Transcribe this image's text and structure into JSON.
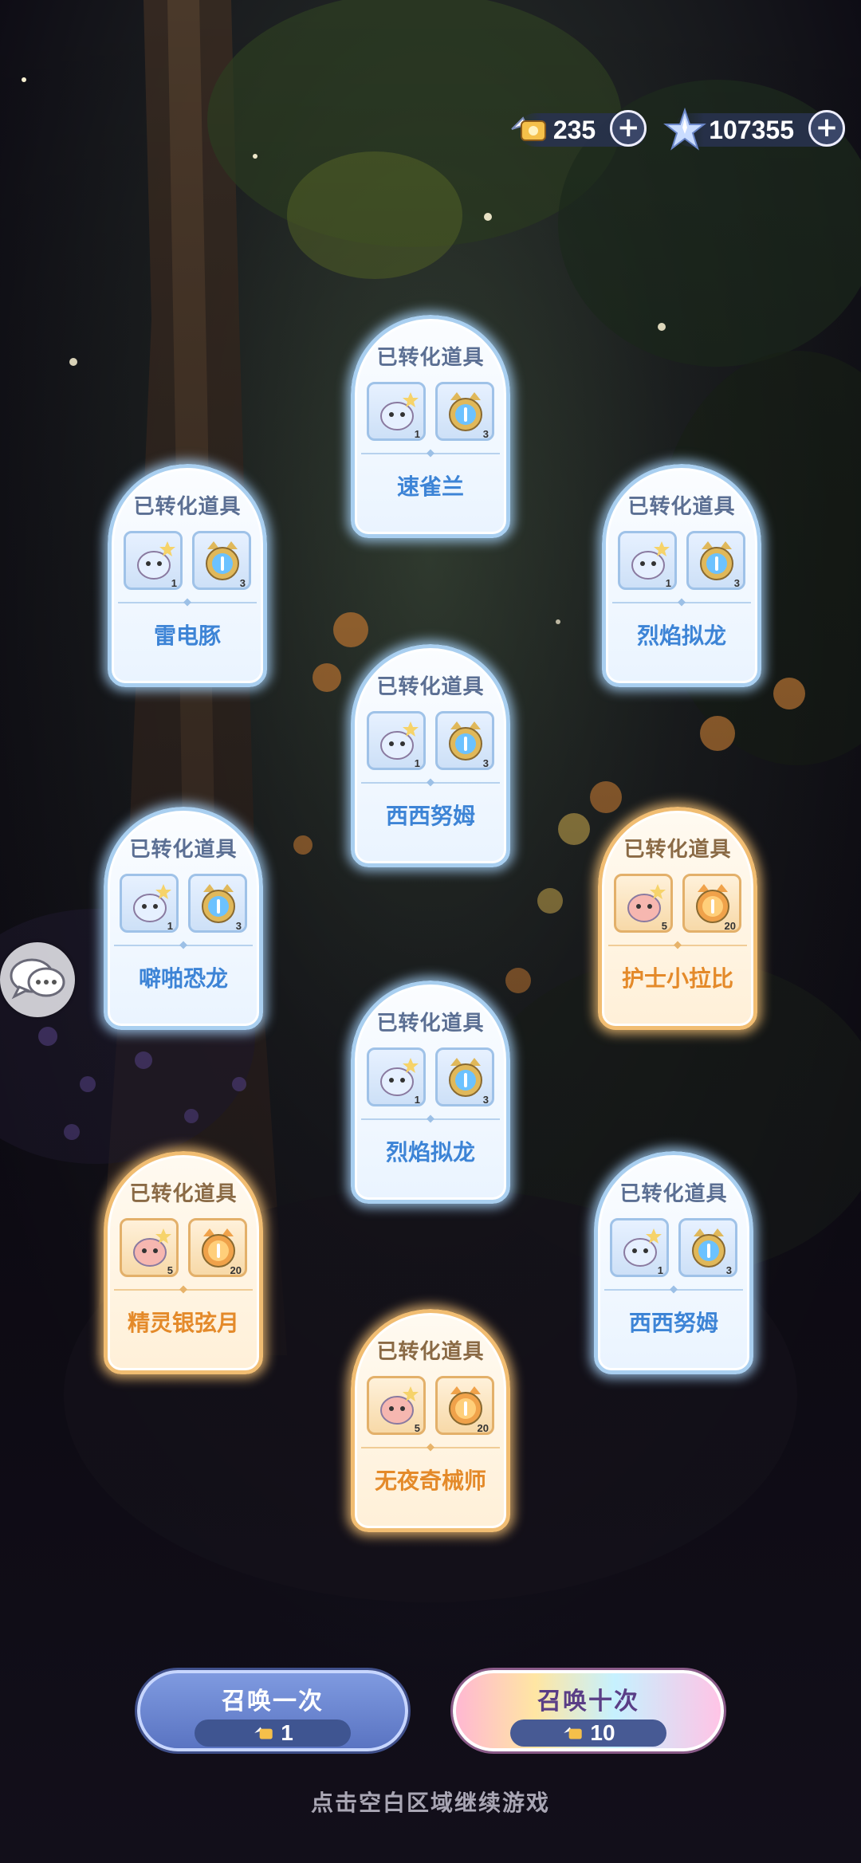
{
  "currency": {
    "tickets": {
      "value": "235",
      "icon": "ticket-wing-icon",
      "plus": "+"
    },
    "stars": {
      "value": "107355",
      "icon": "star-crystal-icon",
      "plus": "+"
    }
  },
  "cards": [
    {
      "title": "已转化道具",
      "name": "速雀兰",
      "rarity": "blue",
      "pet_count": "1",
      "item_count": "3"
    },
    {
      "title": "已转化道具",
      "name": "雷电豚",
      "rarity": "blue",
      "pet_count": "1",
      "item_count": "3"
    },
    {
      "title": "已转化道具",
      "name": "烈焰拟龙",
      "rarity": "blue",
      "pet_count": "1",
      "item_count": "3"
    },
    {
      "title": "已转化道具",
      "name": "西西努姆",
      "rarity": "blue",
      "pet_count": "1",
      "item_count": "3"
    },
    {
      "title": "已转化道具",
      "name": "噼啪恐龙",
      "rarity": "blue",
      "pet_count": "1",
      "item_count": "3"
    },
    {
      "title": "已转化道具",
      "name": "护士小拉比",
      "rarity": "gold",
      "pet_count": "5",
      "item_count": "20"
    },
    {
      "title": "已转化道具",
      "name": "烈焰拟龙",
      "rarity": "blue",
      "pet_count": "1",
      "item_count": "3"
    },
    {
      "title": "已转化道具",
      "name": "精灵银弦月",
      "rarity": "gold",
      "pet_count": "5",
      "item_count": "20"
    },
    {
      "title": "已转化道具",
      "name": "西西努姆",
      "rarity": "blue",
      "pet_count": "1",
      "item_count": "3"
    },
    {
      "title": "已转化道具",
      "name": "无夜奇械师",
      "rarity": "gold",
      "pet_count": "5",
      "item_count": "20"
    }
  ],
  "buttons": {
    "summon_one": {
      "label": "召唤一次",
      "cost": "1"
    },
    "summon_ten": {
      "label": "召唤十次",
      "cost": "10"
    }
  },
  "hint": "点击空白区域继续游戏",
  "colors": {
    "blue_name": "#3d84d6",
    "gold_name": "#e48a2a",
    "bg": "#0f0d18"
  }
}
